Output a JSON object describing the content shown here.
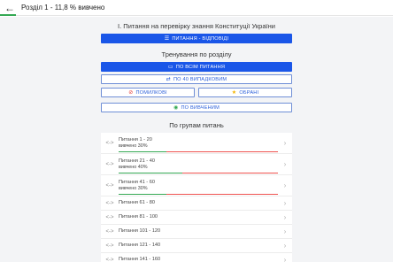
{
  "header": {
    "back_icon": "arrow-left-icon",
    "title": "Розділ 1 - 11,8 % вивчено",
    "progress": 0.118,
    "progress_color": "#34a853",
    "remaining_color": "#ef5350"
  },
  "section": {
    "title": "I. Питання на перевірку знання Конституції України"
  },
  "buttons": {
    "questions_answers": "ПИТАННЯ - ВІДПОВІДІ",
    "training_title": "Тренування по розділу",
    "all_questions": "ПО ВСІМ ПИТАННЯ",
    "random_40": "ПО 40 ВИПАДКОВИМ",
    "mistakes": "ПОМИЛКОВІ",
    "favorites": "ОБРАНІ",
    "studied": "ПО ВИВЧЕНИМ"
  },
  "groups": {
    "title": "По групам питань",
    "items": [
      {
        "label": "Питання 1 - 20",
        "sub": "вивчено 30%",
        "progress": 0.3
      },
      {
        "label": "Питання 21 - 40",
        "sub": "вивчено 40%",
        "progress": 0.4
      },
      {
        "label": "Питання 41 - 60",
        "sub": "вивчено 30%",
        "progress": 0.3
      },
      {
        "label": "Питання 61 - 80"
      },
      {
        "label": "Питання 81 - 100"
      },
      {
        "label": "Питання 101 - 120"
      },
      {
        "label": "Питання 121 - 140"
      },
      {
        "label": "Питання 141 - 160"
      }
    ]
  },
  "colors": {
    "primary": "#1a56e8",
    "outline_text": "#2b5fd9",
    "background": "#f3f4f6",
    "favorite_star": "#f4b400",
    "mistake_icon": "#e53935",
    "studied_icon": "#34a853"
  }
}
